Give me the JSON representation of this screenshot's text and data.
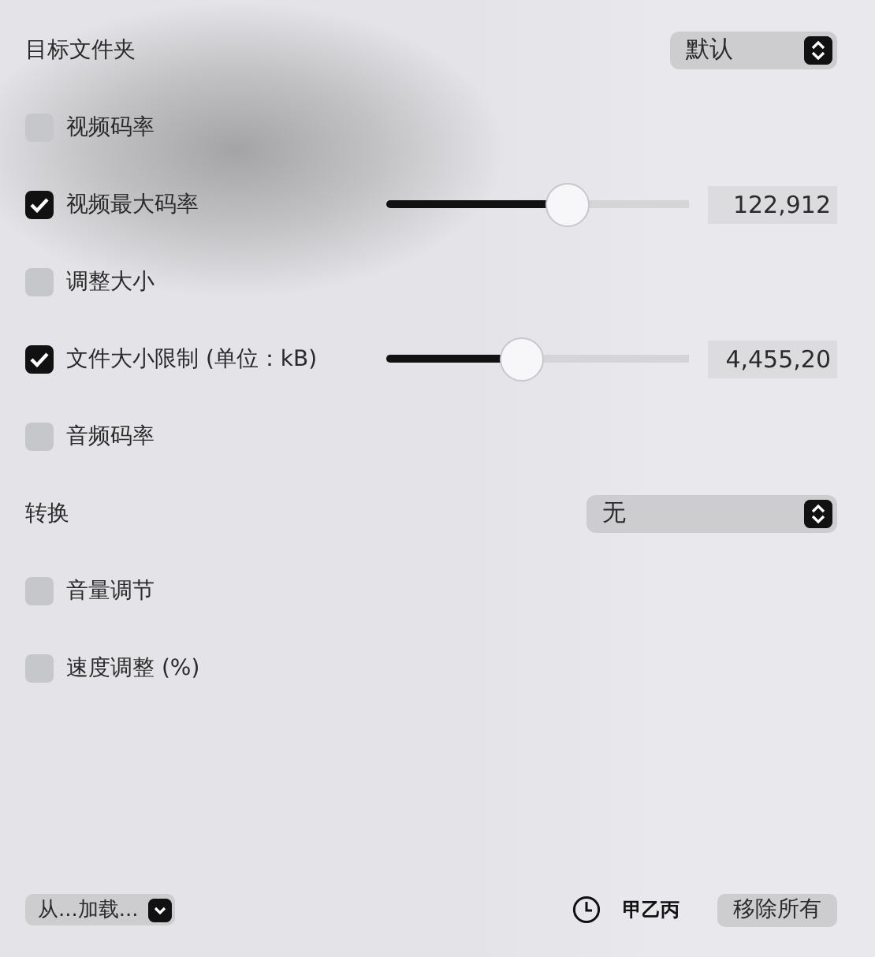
{
  "rows": [
    {
      "kind": "popup",
      "label": "目标文件夹",
      "value": "默认"
    },
    {
      "kind": "checkbox",
      "label": "视频码率",
      "checked": false
    },
    {
      "kind": "slider",
      "label": "视频最大码率",
      "checked": true,
      "level": 0.6,
      "value": "122,912"
    },
    {
      "kind": "checkbox",
      "label": "调整大小",
      "checked": false
    },
    {
      "kind": "slider",
      "label": "文件大小限制 (单位：kB)",
      "checked": true,
      "level": 0.45,
      "value": "4,455,20"
    },
    {
      "kind": "checkbox",
      "label": "音频码率",
      "checked": false
    },
    {
      "kind": "popup",
      "label": "转换",
      "value": "无",
      "wide": true
    },
    {
      "kind": "checkbox",
      "label": "音量调节",
      "checked": false
    },
    {
      "kind": "checkbox",
      "label": "速度调整 (%)",
      "checked": false
    }
  ],
  "footer": {
    "load_menu": "从...加载...",
    "clock_label": "甲乙丙",
    "remove_button": "移除所有"
  }
}
